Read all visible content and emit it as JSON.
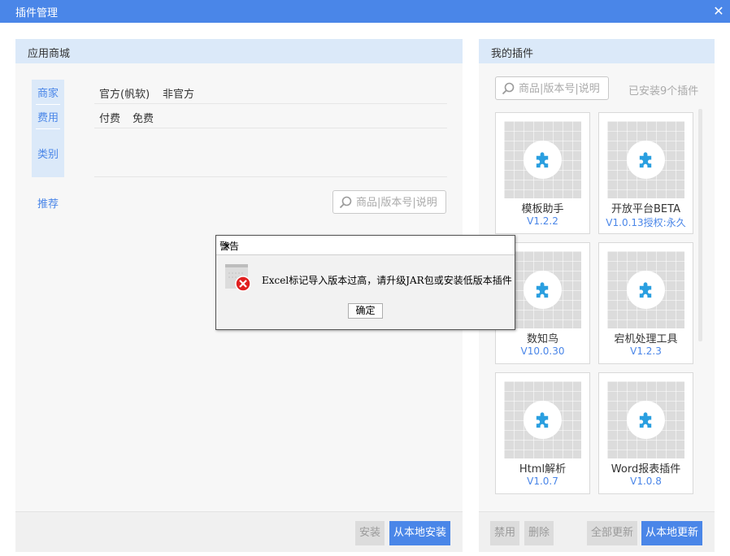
{
  "window": {
    "title": "插件管理",
    "close_glyph": "✕"
  },
  "store": {
    "header": "应用商城",
    "filters": [
      {
        "label": "商家",
        "options": [
          "官方(帆软)",
          "非官方"
        ]
      },
      {
        "label": "费用",
        "options": [
          "付费",
          "免费"
        ]
      },
      {
        "label": "类别",
        "options": []
      }
    ],
    "recommend_label": "推荐",
    "search_placeholder": "商品|版本号|说明",
    "footer": {
      "install": "安装",
      "install_local": "从本地安装"
    }
  },
  "my_plugins": {
    "header": "我的插件",
    "search_placeholder": "商品|版本号|说明",
    "installed_count": "已安装9个插件",
    "cards": [
      {
        "name": "模板助手",
        "version": "V1.2.2"
      },
      {
        "name": "开放平台BETA",
        "version": "V1.0.13授权:永久"
      },
      {
        "name": "数知鸟",
        "version": "V10.0.30"
      },
      {
        "name": "宕机处理工具",
        "version": "V1.2.3"
      },
      {
        "name": "Html解析",
        "version": "V1.0.7"
      },
      {
        "name": "Word报表插件",
        "version": "V1.0.8"
      }
    ],
    "footer": {
      "disable": "禁用",
      "delete": "删除",
      "update_all": "全部更新",
      "update_local": "从本地更新"
    }
  },
  "dialog": {
    "title": "警告",
    "close_glyph": "✕",
    "message": "Excel标记导入版本过高，请升级JAR包或安装低版本插件",
    "ok": "确定"
  },
  "colors": {
    "accent": "#4a86e8",
    "header_bg": "#dbe9f9",
    "puzzle": "#2a9fe0",
    "error": "#e02020"
  }
}
